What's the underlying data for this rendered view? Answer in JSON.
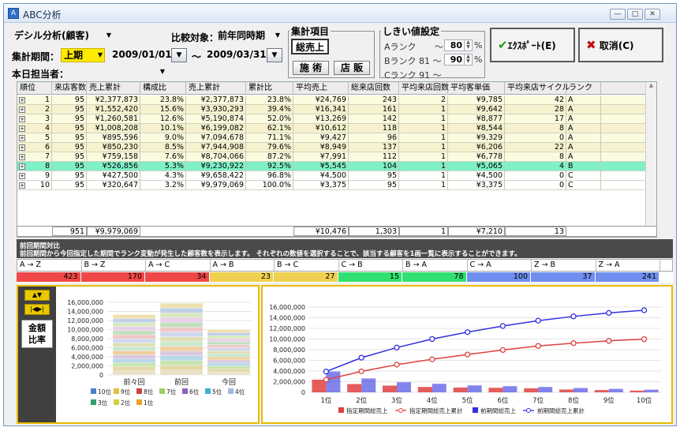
{
  "window": {
    "title": "ABC分析",
    "app_icon": "A",
    "minimize": "—",
    "maximize": "□",
    "close": "✕"
  },
  "toolbar": {
    "analysis_type": "デシル分析(顧客)",
    "compare_label": "比較対象：",
    "compare_value": "前年同時期",
    "period_label": "集計期間：",
    "period_value": "上期",
    "date_from": "2009/01/01",
    "date_to": "2009/03/31",
    "tilde": "～",
    "staff_label": "本日担当者：",
    "staff_value": ""
  },
  "summary_items": {
    "title": "集計項目",
    "total_sales": "総売上",
    "facility": "施 術",
    "store": "店 販"
  },
  "threshold": {
    "title": "しきい値設定",
    "rows": [
      {
        "label": "Aランク",
        "sep": "～",
        "value": "80",
        "unit": "%"
      },
      {
        "label": "Bランク 81 ～",
        "sep": "",
        "value": "90",
        "unit": "%"
      },
      {
        "label": "Cランク 91 ～",
        "sep": "",
        "value": "",
        "unit": ""
      }
    ]
  },
  "actions": {
    "export": "ｴｸｽﾎﾟｰﾄ(E)",
    "cancel": "取消(C)"
  },
  "grid": {
    "headers": [
      "順位",
      "来店客数",
      "売上累計",
      "構成比",
      "売上累計",
      "累計比",
      "平均売上",
      "総来店回数",
      "平均来店回数",
      "平均客単価",
      "平均来店サイクル",
      "ランク"
    ],
    "rows": [
      [
        "1",
        "95",
        "¥2,377,873",
        "23.8%",
        "¥2,377,873",
        "23.8%",
        "¥24,769",
        "243",
        "2",
        "¥9,785",
        "42",
        "A"
      ],
      [
        "2",
        "95",
        "¥1,552,420",
        "15.6%",
        "¥3,930,293",
        "39.4%",
        "¥16,341",
        "161",
        "1",
        "¥9,642",
        "28",
        "A"
      ],
      [
        "3",
        "95",
        "¥1,260,581",
        "12.6%",
        "¥5,190,874",
        "52.0%",
        "¥13,269",
        "142",
        "1",
        "¥8,877",
        "17",
        "A"
      ],
      [
        "4",
        "95",
        "¥1,008,208",
        "10.1%",
        "¥6,199,082",
        "62.1%",
        "¥10,612",
        "118",
        "1",
        "¥8,544",
        "8",
        "A"
      ],
      [
        "5",
        "95",
        "¥895,596",
        "9.0%",
        "¥7,094,678",
        "71.1%",
        "¥9,427",
        "96",
        "1",
        "¥9,329",
        "0",
        "A"
      ],
      [
        "6",
        "95",
        "¥850,230",
        "8.5%",
        "¥7,944,908",
        "79.6%",
        "¥8,949",
        "137",
        "1",
        "¥6,206",
        "22",
        "A"
      ],
      [
        "7",
        "95",
        "¥759,158",
        "7.6%",
        "¥8,704,066",
        "87.2%",
        "¥7,991",
        "112",
        "1",
        "¥6,778",
        "8",
        "A"
      ],
      [
        "8",
        "95",
        "¥526,856",
        "5.3%",
        "¥9,230,922",
        "92.5%",
        "¥5,545",
        "104",
        "1",
        "¥5,065",
        "4",
        "B"
      ],
      [
        "9",
        "95",
        "¥427,500",
        "4.3%",
        "¥9,658,422",
        "96.8%",
        "¥4,500",
        "95",
        "1",
        "¥4,500",
        "0",
        "C"
      ],
      [
        "10",
        "95",
        "¥320,647",
        "3.2%",
        "¥9,979,069",
        "100.0%",
        "¥3,375",
        "95",
        "1",
        "¥3,375",
        "0",
        "C"
      ]
    ],
    "totals": {
      "customers": "951",
      "sales": "¥9,979,069",
      "avg_sales": "¥10,476",
      "visits": "1,303",
      "avg_visits": "1",
      "avg_price": "¥7,210",
      "cycle": "13"
    }
  },
  "prev_compare": {
    "title": "前回期間対比",
    "desc": "前回期間から今回指定した期間でランク変動が発生した顧客数を表示します。 それぞれの数値を選択することで、該当する顧客を1画一覧に表示することができます。"
  },
  "transitions": {
    "headers": [
      "A → Z",
      "B → Z",
      "A → C",
      "A → B",
      "B → C",
      "C → B",
      "B → A",
      "C → A",
      "Z → B",
      "Z → A"
    ],
    "values": [
      "423",
      "170",
      "34",
      "23",
      "27",
      "15",
      "78",
      "100",
      "37",
      "241"
    ],
    "colors": [
      "#f04848",
      "#f04848",
      "#f04848",
      "#f0d050",
      "#f0d050",
      "#30e070",
      "#30e070",
      "#6f8ef0",
      "#6f8ef0",
      "#6f8ef0"
    ]
  },
  "left_panel": {
    "up_button": "▲▼",
    "range_button": "|◀▶|",
    "mode_amount": "金額",
    "mode_ratio": "比率"
  },
  "chart_left": {
    "type": "bar",
    "categories": [
      "前々回",
      "前回",
      "今回"
    ],
    "ylim": [
      0,
      16000000
    ],
    "yticks": [
      "0",
      "2,000,000",
      "4,000,000",
      "6,000,000",
      "8,000,000",
      "10,000,000",
      "12,000,000",
      "14,000,000",
      "16,000,000"
    ],
    "totals": [
      13300000,
      15800000,
      9979069
    ],
    "legend": [
      {
        "name": "10位",
        "color": "#4a7fd4"
      },
      {
        "name": "9位",
        "color": "#e0c040"
      },
      {
        "name": "8位",
        "color": "#d04040"
      },
      {
        "name": "7位",
        "color": "#9ad060"
      },
      {
        "name": "6位",
        "color": "#8a60c0"
      },
      {
        "name": "5位",
        "color": "#40b0d0"
      },
      {
        "name": "4位",
        "color": "#a0b8e0"
      },
      {
        "name": "3位",
        "color": "#30a070"
      },
      {
        "name": "2位",
        "color": "#d0d040"
      },
      {
        "name": "1位",
        "color": "#f0a020"
      }
    ]
  },
  "chart_right": {
    "type": "bar",
    "categories": [
      "1位",
      "2位",
      "3位",
      "4位",
      "5位",
      "6位",
      "7位",
      "8位",
      "9位",
      "10位"
    ],
    "ylim": [
      0,
      16000000
    ],
    "yticks": [
      "0",
      "2,000,000",
      "4,000,000",
      "6,000,000",
      "8,000,000",
      "10,000,000",
      "12,000,000",
      "14,000,000",
      "16,000,000"
    ],
    "series": [
      {
        "name": "指定期間総売上",
        "kind": "bar",
        "color": "#e04040",
        "values": [
          2377873,
          1552420,
          1260581,
          1008208,
          895596,
          850230,
          759158,
          526856,
          427500,
          320647
        ]
      },
      {
        "name": "指定期間総売上累計",
        "kind": "line",
        "color": "#e04040",
        "values": [
          2377873,
          3930293,
          5190874,
          6199082,
          7094678,
          7944908,
          8704066,
          9230922,
          9658422,
          9979069
        ]
      },
      {
        "name": "前期間総売上",
        "kind": "bar",
        "color": "#3030e0",
        "values": [
          3900000,
          2600000,
          1900000,
          1600000,
          1300000,
          1150000,
          1000000,
          800000,
          650000,
          500000
        ]
      },
      {
        "name": "前期間総売上累計",
        "kind": "line",
        "color": "#3030e0",
        "values": [
          3900000,
          6500000,
          8400000,
          10000000,
          11300000,
          12450000,
          13450000,
          14250000,
          14900000,
          15400000
        ]
      }
    ]
  }
}
